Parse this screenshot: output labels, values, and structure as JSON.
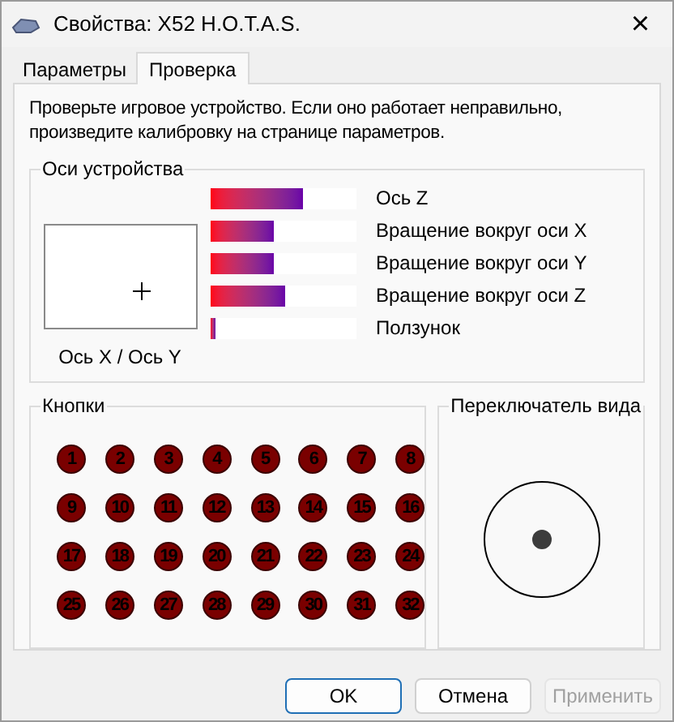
{
  "window": {
    "title": "Свойства: X52 H.O.T.A.S.",
    "close": "×"
  },
  "tabs": [
    {
      "label": "Параметры",
      "selected": false
    },
    {
      "label": "Проверка",
      "selected": true
    }
  ],
  "intro": "Проверьте игровое устройство. Если оно работает неправильно, произведите калибровку на странице параметров.",
  "axes_group": {
    "title": "Оси устройства",
    "xy_label": "Ось X / Ось Y",
    "axes": [
      {
        "name": "Ось Z",
        "level": 0.63
      },
      {
        "name": "Вращение вокруг оси X",
        "level": 0.43
      },
      {
        "name": "Вращение вокруг оси Y",
        "level": 0.43
      },
      {
        "name": "Вращение вокруг оси Z",
        "level": 0.51
      },
      {
        "name": "Ползунок",
        "level": 0.03
      }
    ]
  },
  "buttons_group": {
    "title": "Кнопки",
    "buttons": [
      {
        "label": "1",
        "pressed": false
      },
      {
        "label": "2",
        "pressed": false
      },
      {
        "label": "3",
        "pressed": false
      },
      {
        "label": "4",
        "pressed": false
      },
      {
        "label": "5",
        "pressed": false
      },
      {
        "label": "6",
        "pressed": false
      },
      {
        "label": "7",
        "pressed": false
      },
      {
        "label": "8",
        "pressed": false
      },
      {
        "label": "9",
        "pressed": false
      },
      {
        "label": "10",
        "pressed": false
      },
      {
        "label": "11",
        "pressed": false
      },
      {
        "label": "12",
        "pressed": false
      },
      {
        "label": "13",
        "pressed": false
      },
      {
        "label": "14",
        "pressed": false
      },
      {
        "label": "15",
        "pressed": false
      },
      {
        "label": "16",
        "pressed": false
      },
      {
        "label": "17",
        "pressed": false
      },
      {
        "label": "18",
        "pressed": false
      },
      {
        "label": "19",
        "pressed": false
      },
      {
        "label": "20",
        "pressed": false
      },
      {
        "label": "21",
        "pressed": false
      },
      {
        "label": "22",
        "pressed": false
      },
      {
        "label": "23",
        "pressed": false
      },
      {
        "label": "24",
        "pressed": false
      },
      {
        "label": "25",
        "pressed": false
      },
      {
        "label": "26",
        "pressed": false
      },
      {
        "label": "27",
        "pressed": false
      },
      {
        "label": "28",
        "pressed": false
      },
      {
        "label": "29",
        "pressed": false
      },
      {
        "label": "30",
        "pressed": false
      },
      {
        "label": "31",
        "pressed": false
      },
      {
        "label": "32",
        "pressed": false
      }
    ]
  },
  "pov_group": {
    "title": "Переключатель вида"
  },
  "dialog_buttons": [
    {
      "label": "OK",
      "kind": "default",
      "disabled": false
    },
    {
      "label": "Отмена",
      "kind": "normal",
      "disabled": false
    },
    {
      "label": "Применить",
      "kind": "normal",
      "disabled": true
    }
  ]
}
